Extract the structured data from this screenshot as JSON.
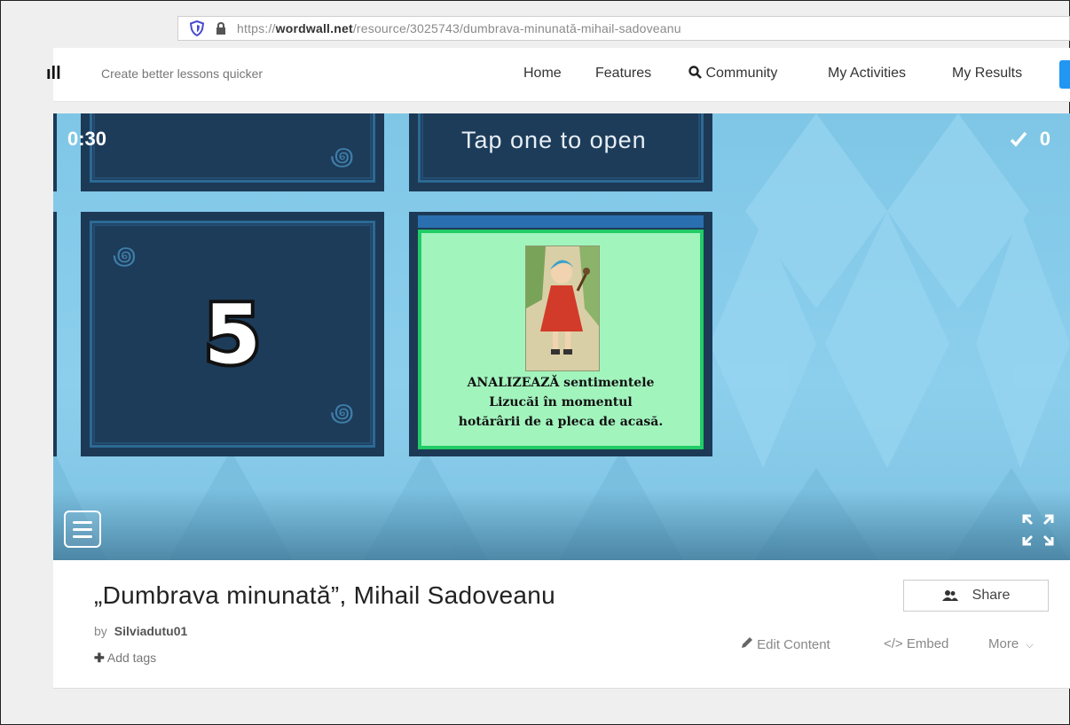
{
  "browser": {
    "url_prefix": "https://",
    "url_domain": "wordwall.net",
    "url_path": "/resource/3025743/dumbrava-minunată-mihail-sadoveanu"
  },
  "site": {
    "logo": "ıll",
    "tagline": "Create better lessons quicker",
    "nav": {
      "home": "Home",
      "features": "Features",
      "community": "Community",
      "activities": "My Activities",
      "results": "My Results"
    },
    "accent_color": "#2196f3"
  },
  "game": {
    "timer": "0:30",
    "prompt": "Tap one to open",
    "score": "0",
    "tile_number": "5",
    "open_card_text": [
      "ANALIZEAZĂ sentimentele",
      "Lizucăi în momentul",
      "hotărârii de a pleca de acasă."
    ],
    "background_color": "#84c9e9",
    "tile_color": "#1c3a56",
    "card_color": "#a2f4bd"
  },
  "activity": {
    "title": "„Dumbrava minunată”, Mihail Sadoveanu",
    "by_label": "by",
    "author": "Silviadutu01",
    "add_tags": "Add tags",
    "share": "Share",
    "edit": "Edit Content",
    "embed": "Embed",
    "more": "More"
  }
}
